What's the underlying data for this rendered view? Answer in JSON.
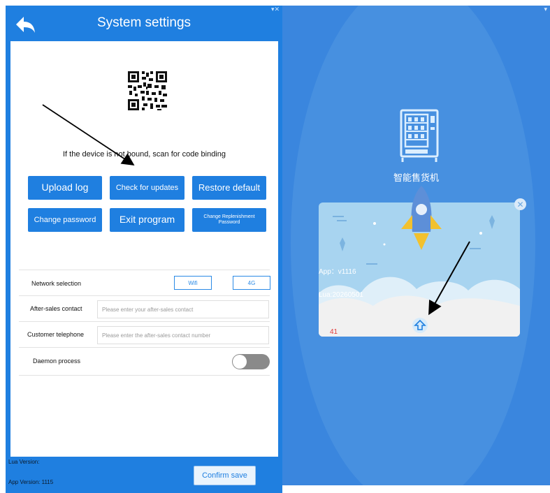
{
  "left": {
    "title": "System settings",
    "bind_text": "If the device is not bound, scan for code binding",
    "buttons": {
      "upload_log": "Upload log",
      "check_updates": "Check for updates",
      "restore_default": "Restore default",
      "change_password": "Change password",
      "exit_program": "Exit program",
      "change_replenishment": "Change Replenishment Password"
    },
    "network": {
      "label": "Network selection",
      "wifi": "Wifi",
      "g4": "4G"
    },
    "after_sales": {
      "label": "After-sales contact",
      "placeholder": "Please enter your after-sales contact"
    },
    "telephone": {
      "label": "Customer telephone",
      "placeholder": "Please enter the after-sales contact number"
    },
    "daemon": {
      "label": "Daemon process",
      "enabled": false
    },
    "lua_version": "Lua Version:",
    "app_version": "App Version: 1115",
    "confirm_save": "Confirm save"
  },
  "right": {
    "app_name": "智能售货机",
    "popup": {
      "app_text": "App：v1116",
      "lua_text": "Lua:20260501",
      "count": "41"
    }
  },
  "colors": {
    "primary": "#1f7fe0",
    "right_bg": "#3a86de",
    "popup_bg": "#a8d4f0",
    "count_red": "#e23b3b"
  },
  "icons": [
    "back-arrow-icon",
    "qr-code-icon",
    "wifi-status-icon",
    "vending-machine-icon",
    "rocket-icon",
    "close-icon",
    "upgrade-arrow-icon"
  ]
}
